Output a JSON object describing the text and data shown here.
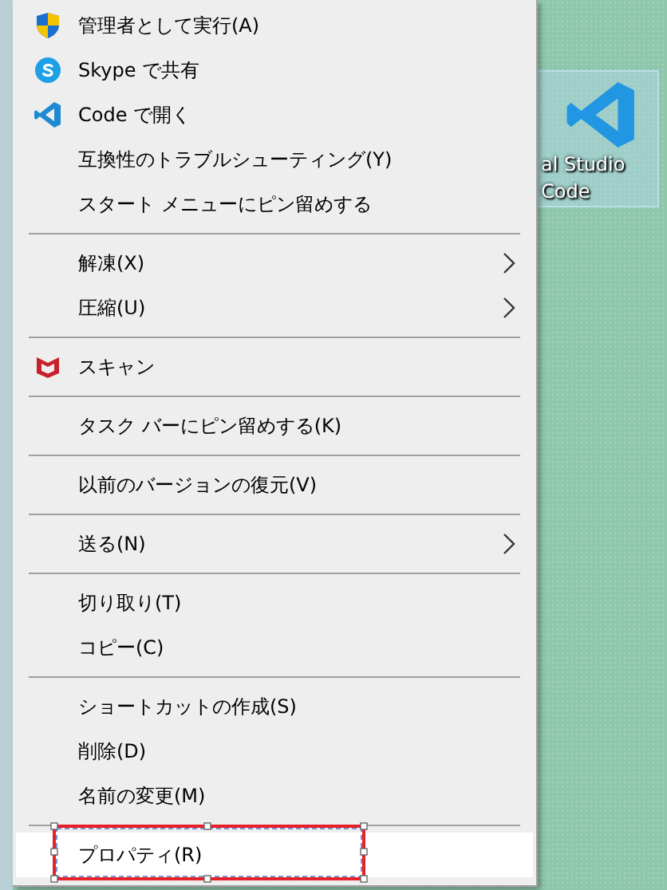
{
  "desktop": {
    "icon_label": [
      "al Studio",
      "Code"
    ]
  },
  "menu": {
    "groups": [
      [
        {
          "label": "管理者として実行(A)",
          "kind": "shield",
          "submenu": false,
          "selected": false,
          "framed": false
        },
        {
          "label": "Skype で共有",
          "kind": "chat",
          "submenu": false,
          "selected": false,
          "framed": false
        },
        {
          "label": "Code で開く",
          "kind": "editor",
          "submenu": false,
          "selected": false,
          "framed": false
        },
        {
          "label": "互換性のトラブルシューティング(Y)",
          "submenu": false,
          "selected": false,
          "framed": false
        },
        {
          "label": "スタート メニューにピン留めする",
          "submenu": false,
          "selected": false,
          "framed": false
        }
      ],
      [
        {
          "label": "解凍(X)",
          "submenu": true,
          "selected": false,
          "framed": false
        },
        {
          "label": "圧縮(U)",
          "submenu": true,
          "selected": false,
          "framed": false
        }
      ],
      [
        {
          "label": "スキャン",
          "kind": "antivirus",
          "submenu": false,
          "selected": false,
          "framed": false
        }
      ],
      [
        {
          "label": "タスク バーにピン留めする(K)",
          "submenu": false,
          "selected": false,
          "framed": false
        }
      ],
      [
        {
          "label": "以前のバージョンの復元(V)",
          "submenu": false,
          "selected": false,
          "framed": false
        }
      ],
      [
        {
          "label": "送る(N)",
          "submenu": true,
          "selected": false,
          "framed": false
        }
      ],
      [
        {
          "label": "切り取り(T)",
          "submenu": false,
          "selected": false,
          "framed": false
        },
        {
          "label": "コピー(C)",
          "submenu": false,
          "selected": false,
          "framed": false
        }
      ],
      [
        {
          "label": "ショートカットの作成(S)",
          "submenu": false,
          "selected": false,
          "framed": false
        },
        {
          "label": "削除(D)",
          "submenu": false,
          "selected": false,
          "framed": false
        },
        {
          "label": "名前の変更(M)",
          "submenu": false,
          "selected": false,
          "framed": false
        }
      ],
      [
        {
          "label": "プロパティ(R)",
          "submenu": false,
          "selected": true,
          "framed": true
        }
      ]
    ]
  }
}
